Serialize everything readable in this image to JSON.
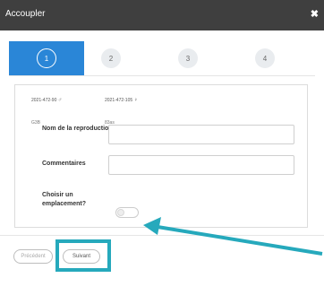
{
  "dialog": {
    "title": "Accoupler",
    "close_glyph": "✖"
  },
  "steps": [
    {
      "label": "1"
    },
    {
      "label": "2"
    },
    {
      "label": "3"
    },
    {
      "label": "4"
    }
  ],
  "animals": [
    {
      "id": "2021-472-90",
      "sex_symbol": "♂",
      "sub": "G3B"
    },
    {
      "id": "2021-472-105",
      "sex_symbol": "♀",
      "sub": "83as"
    }
  ],
  "form": {
    "name_label": "Nom de la reproduction",
    "comments_label": "Commentaires",
    "location_label": "Choisir un emplacement?"
  },
  "buttons": {
    "previous": "Précédent",
    "next": "Suivant"
  },
  "annotation": {
    "color": "#26a9bc"
  }
}
